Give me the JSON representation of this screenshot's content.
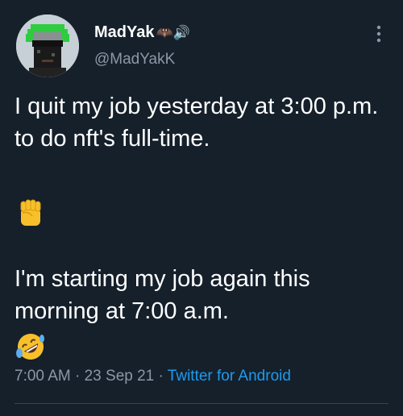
{
  "user": {
    "display_name": "MadYak",
    "name_emoji": "🦇🔊",
    "handle": "@MadYakK"
  },
  "tweet": {
    "line1": "I quit my job yesterday at 3:00 p.m. to do nft's full-time.",
    "emoji1": "fist-emoji",
    "line2": "I'm starting my job again this morning at 7:00 a.m.",
    "emoji2": "rolling-on-floor-laughing-emoji"
  },
  "meta": {
    "time": "7:00 AM",
    "sep1": " · ",
    "date": "23 Sep 21",
    "sep2": " · ",
    "source": "Twitter for Android"
  },
  "icons": {
    "more": "more-vertical-icon"
  },
  "colors": {
    "background": "#15202b",
    "text": "#ffffff",
    "secondary": "#8b98a5",
    "link": "#1d9bf0",
    "avatar_background": "#c7d0d6",
    "avatar_hair": "#2ecc40"
  }
}
